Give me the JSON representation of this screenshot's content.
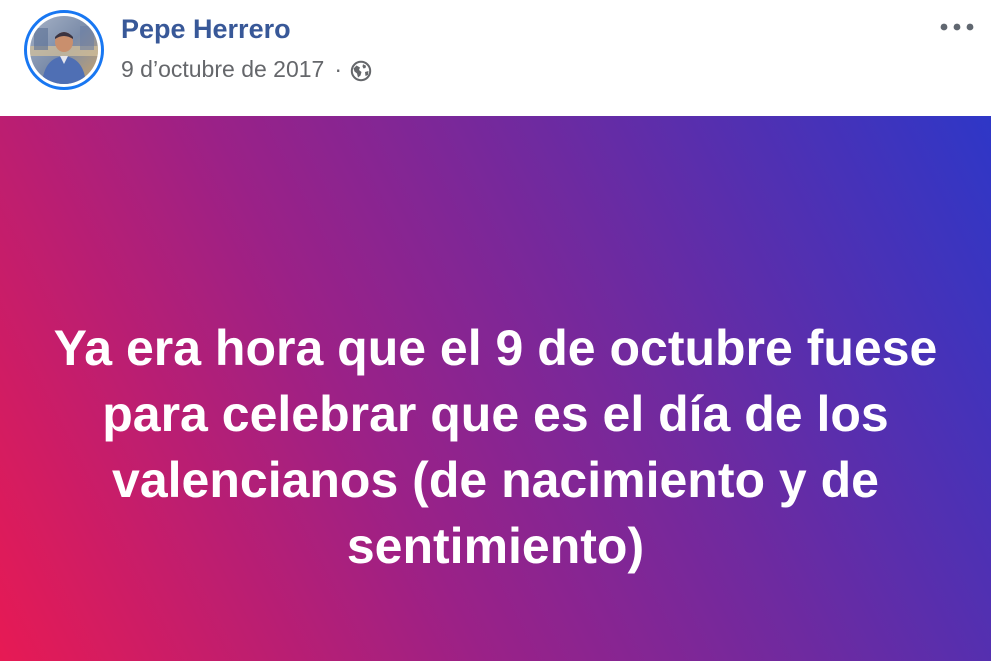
{
  "post": {
    "author": {
      "name": "Pepe Herrero",
      "avatar": "profile-photo"
    },
    "date": "9 d’octubre de 2017",
    "separator": "·",
    "audience_icon": "globe-icon",
    "more_icon": "more-horizontal-icon",
    "message": "Ya era hora que el 9 de octubre fuese para celebrar que es el día de los valencianos (de nacimiento y de sentimiento)",
    "background": {
      "gradient_colors": [
        "#e71a54",
        "#9b2187",
        "#6e2aa0",
        "#2e37c7"
      ],
      "text_color": "#ffffff"
    }
  },
  "colors": {
    "author_name": "#385898",
    "meta_text": "#65676b",
    "avatar_ring": "#1877f2"
  }
}
